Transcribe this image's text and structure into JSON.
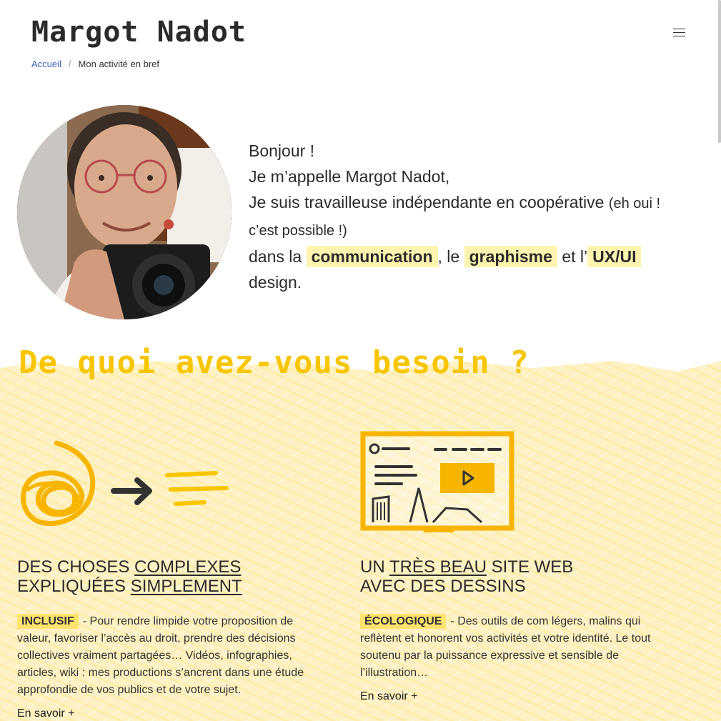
{
  "site": {
    "logo": "Margot Nadot",
    "menu_icon": "hamburger-menu-icon"
  },
  "breadcrumb": {
    "home": "Accueil",
    "separator": "/",
    "current": "Mon activité en bref"
  },
  "intro": {
    "greeting": "Bonjour !",
    "name_line": "Je m’appelle Margot Nadot,",
    "status_line": "Je suis travailleuse indépendante en coopérative",
    "status_aside": "(eh oui ! c’est possible !)",
    "fields_prefix": "dans la",
    "field_1": "communication",
    "sep_1": ", le",
    "field_2": "graphisme",
    "sep_2": "et l’",
    "field_3": "UX/UI",
    "fields_suffix": "design."
  },
  "needs": {
    "title": "De quoi avez-vous besoin ?",
    "cards": [
      {
        "title_1": "DES CHOSES",
        "title_2": "COMPLEXES",
        "title_3": "EXPLIQUÉES",
        "title_4": "SIMPLEMENT",
        "tag": "INCLUSIF",
        "text": "- Pour rendre limpide votre proposition de valeur, favoriser l’accès au droit, prendre des décisions collectives vraiment partagées… Vidéos, infographies, articles, wiki : mes productions s’ancrent dans une étude approfondie de vos publics et de votre sujet.",
        "link": "En savoir +"
      },
      {
        "title_1": "UN",
        "title_2": "TRÈS BEAU",
        "title_3": "SITE WEB",
        "title_4": "AVEC DES DESSINS",
        "tag": "ÉCOLOGIQUE",
        "text": "- Des outils de com légers, malins qui reflètent et honorent vos activités et votre identité. Le tout soutenu par la puissance expressive et sensible de l’illustration…",
        "link": "En savoir +"
      }
    ]
  },
  "colors": {
    "accent_yellow": "#f7c600",
    "highlight": "#fff3b0",
    "tag": "#ffe36e",
    "link_blue": "#3d64b8",
    "section_bg": "#fef1c3"
  }
}
